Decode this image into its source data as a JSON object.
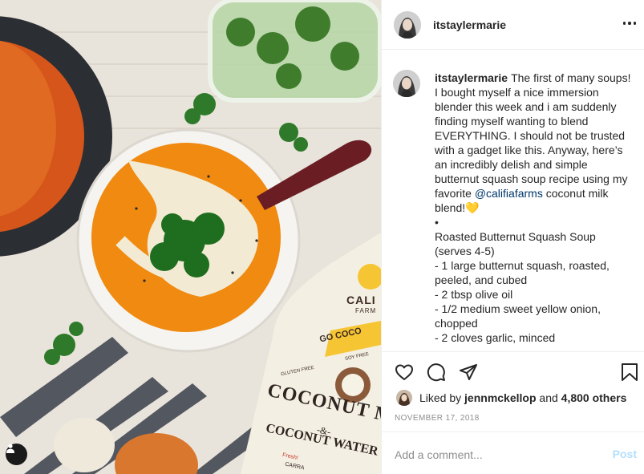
{
  "post": {
    "username": "itstaylermarie",
    "more_icon": "more-horizontal-icon",
    "caption": {
      "username": "itstaylermarie",
      "text_lines": [
        "The first of many soups!",
        "I bought myself a nice immersion",
        "blender this week and i am suddenly",
        "finding myself wanting to blend",
        "EVERYTHING. I should not be trusted",
        "with a gadget like this. Anyway, here’s",
        "an incredibly delish and simple",
        "butternut squash soup recipe using my"
      ],
      "favorite_prefix": "favorite",
      "mention": "@califiafarms",
      "favorite_suffix": "coconut milk",
      "blend_line": "blend!",
      "emoji": "💛",
      "bullet": "•",
      "recipe_lines": [
        "Roasted Butternut Squash Soup",
        "(serves 4-5)",
        "- 1 large butternut squash, roasted,",
        "peeled, and cubed",
        "- 2 tbsp olive oil",
        "- 1/2 medium sweet yellow onion,",
        "chopped",
        "- 2 cloves garlic, minced"
      ]
    },
    "likes": {
      "prefix": "Liked by",
      "user": "jennmckellop",
      "connector": "and",
      "others": "4,800 others"
    },
    "date": "NOVEMBER 17, 2018",
    "comment_placeholder": "Add a comment...",
    "post_label": "Post"
  },
  "photo": {
    "bottle_text": {
      "brand": "CALI",
      "farms": "FARM",
      "go_coco": "GO COCO",
      "soy_free": "SOY FREE",
      "gluten_free": "GLUTEN FREE",
      "coconut": "COCONUT M",
      "amp": "-&-",
      "coconut_water": "COCONUT WATER",
      "fresh": "Fresh!",
      "carra": "CARRA"
    },
    "user_tag_icon": "person-icon"
  },
  "colors": {
    "text": "#262626",
    "secondary": "#8e8e8e",
    "link": "#00376b",
    "post_disabled": "#b2dffc",
    "border": "#efefef"
  }
}
